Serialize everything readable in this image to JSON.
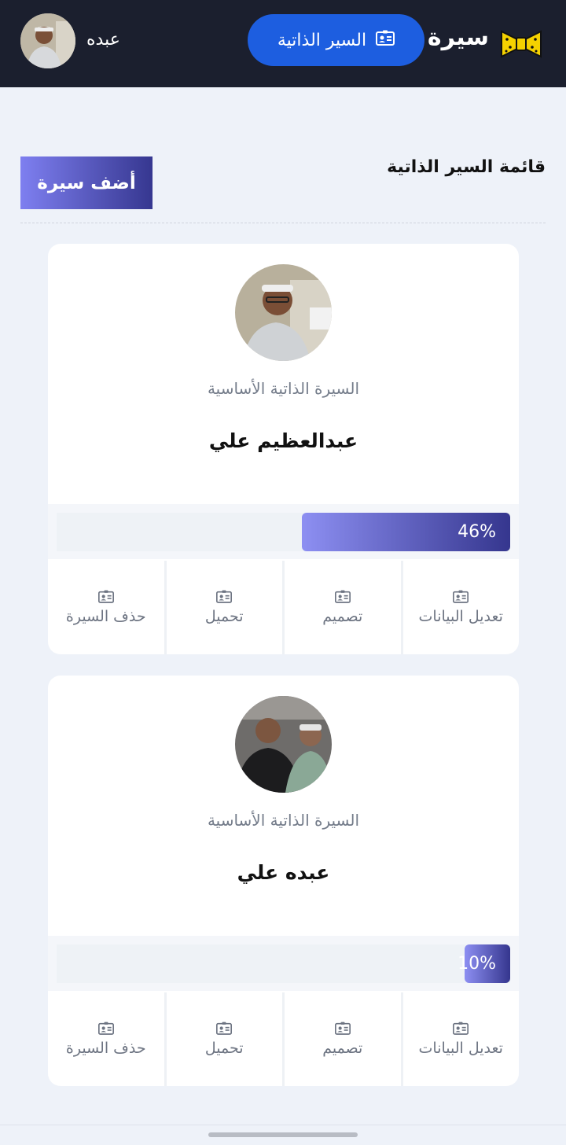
{
  "header": {
    "brand": "سيرة",
    "nav_label": "السير الذاتية",
    "user_name": "عبده",
    "colors": {
      "bar": "#1b1f2e",
      "pill": "#1d5ee0",
      "logo": "#f5d100"
    }
  },
  "main": {
    "title": "قائمة السير الذاتية",
    "add_button": "أضف سيرة"
  },
  "cards": [
    {
      "subtitle": "السيرة الذاتية الأساسية",
      "name": "عبدالعظيم علي",
      "progress_label": "46%",
      "progress": 0.46,
      "actions": [
        "تعديل البيانات",
        "تصميم",
        "تحميل",
        "حذف السيرة"
      ]
    },
    {
      "subtitle": "السيرة الذاتية الأساسية",
      "name": "عبده علي",
      "progress_label": "10%",
      "progress": 0.1,
      "actions": [
        "تعديل البيانات",
        "تصميم",
        "تحميل",
        "حذف السيرة"
      ]
    }
  ]
}
